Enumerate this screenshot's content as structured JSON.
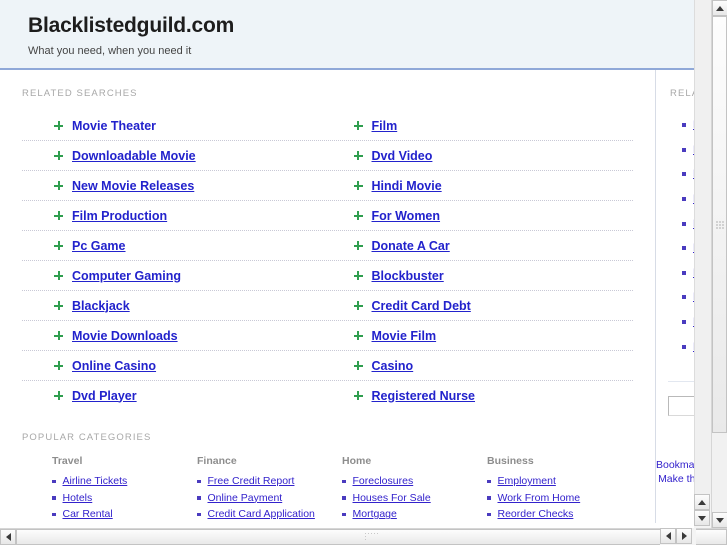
{
  "header": {
    "site_title": "Blacklistedguild.com",
    "tagline": "What you need, when you need it"
  },
  "sections": {
    "related_searches_caption": "RELATED SEARCHES",
    "popular_categories_caption": "POPULAR CATEGORIES",
    "sidebar_related_caption": "RELATED"
  },
  "related_searches": {
    "rows": [
      {
        "left": "Movie Theater",
        "left_underlined": false,
        "right": "Film"
      },
      {
        "left": "Downloadable Movie",
        "left_underlined": true,
        "right": "Dvd Video"
      },
      {
        "left": "New Movie Releases",
        "left_underlined": true,
        "right": "Hindi Movie"
      },
      {
        "left": "Film Production",
        "left_underlined": true,
        "right": "For Women"
      },
      {
        "left": "Pc Game",
        "left_underlined": true,
        "right": "Donate A Car"
      },
      {
        "left": "Computer Gaming",
        "left_underlined": true,
        "right": "Blockbuster"
      },
      {
        "left": "Blackjack",
        "left_underlined": true,
        "right": "Credit Card Debt"
      },
      {
        "left": "Movie Downloads",
        "left_underlined": true,
        "right": "Movie Film"
      },
      {
        "left": "Online Casino",
        "left_underlined": true,
        "right": "Casino"
      },
      {
        "left": "Dvd Player",
        "left_underlined": true,
        "right": "Registered Nurse"
      }
    ]
  },
  "sidebar": {
    "items": [
      "Movie Theater",
      "Film",
      "Downloadable Movie",
      "Dvd Video",
      "New Movie Releases",
      "Hindi Movie",
      "Film Production",
      "For Women",
      "Pc Game",
      "Donate A Car"
    ],
    "search_value": "",
    "search_placeholder": "",
    "footer_line1": "Bookmark",
    "footer_line2": "Make this"
  },
  "popular_categories": {
    "columns": [
      {
        "heading": "Travel",
        "links": [
          "Airline Tickets",
          "Hotels",
          "Car Rental"
        ]
      },
      {
        "heading": "Finance",
        "links": [
          "Free Credit Report",
          "Online Payment",
          "Credit Card Application"
        ]
      },
      {
        "heading": "Home",
        "links": [
          "Foreclosures",
          "Houses For Sale",
          "Mortgage"
        ]
      },
      {
        "heading": "Business",
        "links": [
          "Employment",
          "Work From Home",
          "Reorder Checks"
        ]
      }
    ]
  },
  "colors": {
    "header_bg": "#eef4f8",
    "header_border": "#8fa8d8",
    "link": "#2222cc",
    "bullet_green": "#2f9e4f",
    "bullet_purple": "#4a3bbf",
    "caption_gray": "#a8a8a8"
  }
}
